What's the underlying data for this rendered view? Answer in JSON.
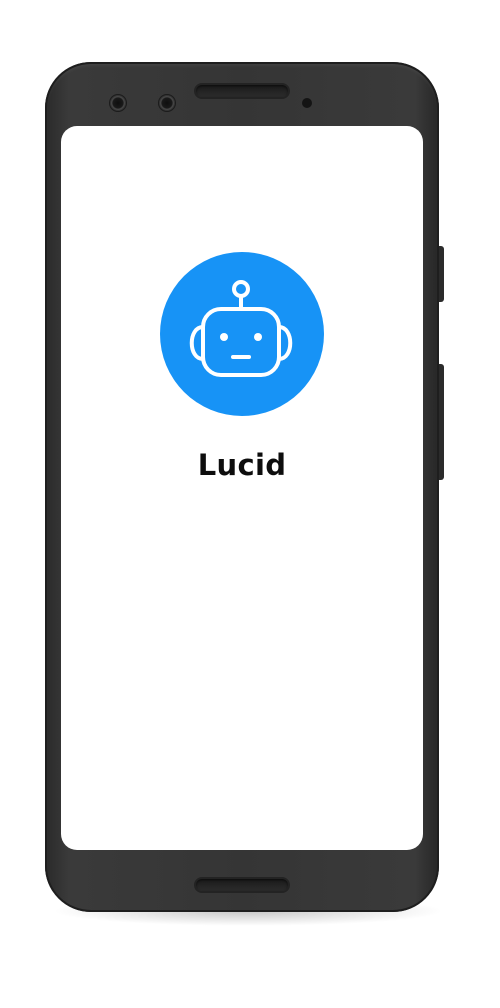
{
  "app": {
    "name": "Lucid",
    "logo_icon": "robot-face-icon",
    "accent_color": "#1793F6"
  },
  "device": {
    "frame_color": "#353535",
    "screen_color": "#FFFFFF"
  }
}
